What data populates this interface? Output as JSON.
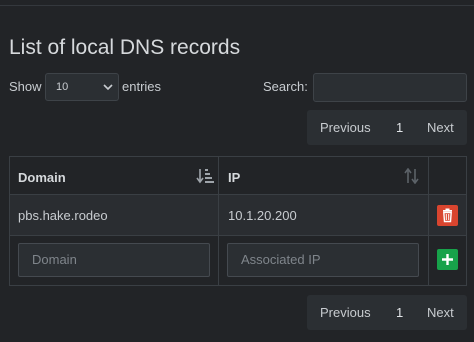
{
  "page": {
    "title": "List of local DNS records"
  },
  "length_control": {
    "show_label": "Show",
    "selected": "10",
    "entries_label": "entries"
  },
  "search": {
    "label": "Search:",
    "value": ""
  },
  "pagination": {
    "previous": "Previous",
    "current_page": "1",
    "next": "Next"
  },
  "table": {
    "columns": [
      "Domain",
      "IP"
    ],
    "rows": [
      {
        "domain": "pbs.hake.rodeo",
        "ip": "10.1.20.200"
      }
    ],
    "new_row": {
      "domain_placeholder": "Domain",
      "ip_placeholder": "Associated IP"
    }
  },
  "colors": {
    "background": "#222427",
    "delete_button": "#d9452f",
    "add_button": "#17a24a"
  },
  "icons": {
    "domain_sort": "sort-amount-desc-icon",
    "ip_sort": "sort-icon",
    "delete": "trash-icon",
    "add": "plus-icon"
  }
}
